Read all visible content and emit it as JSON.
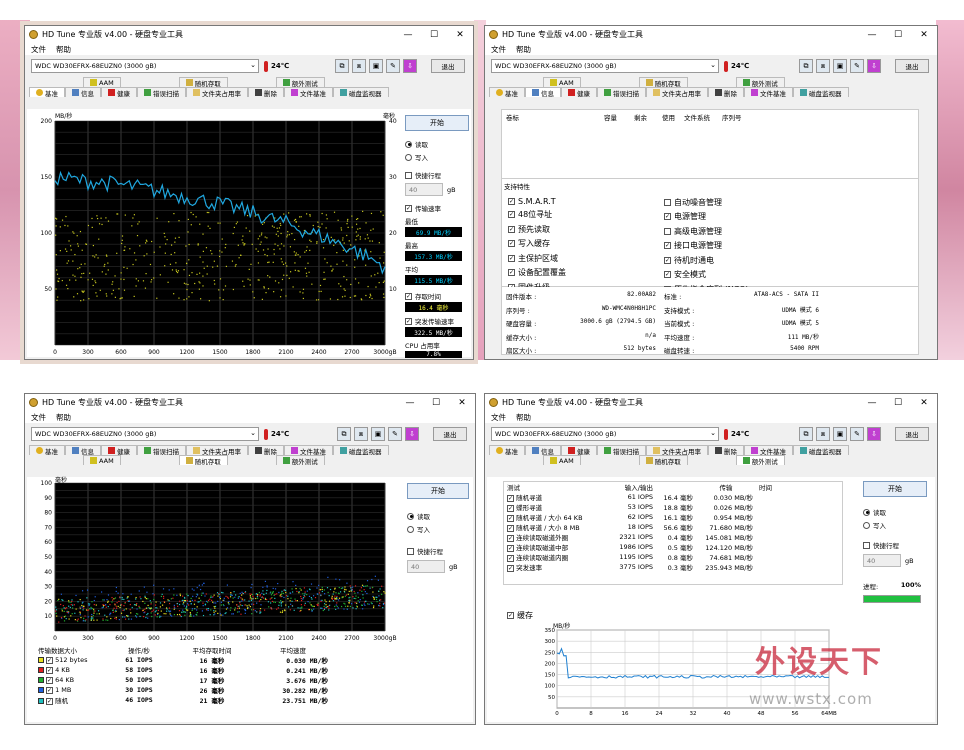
{
  "app": {
    "title": "HD Tune 专业版 v4.00 - 硬盘专业工具",
    "menu": [
      "文件",
      "帮助"
    ],
    "drive": "WDC WD30EFRX-68EUZN0 (3000 gB)",
    "temp": "24℃",
    "exit_label": "退出",
    "tabs_top": [
      "AAM",
      "随机存取",
      "额外测试"
    ],
    "tabs_bottom": [
      "基准",
      "信息",
      "健康",
      "错误扫描",
      "文件夹占用率",
      "删除",
      "文件基准",
      "磁盘监视器"
    ]
  },
  "benchmark": {
    "unit_left": "MB/秒",
    "unit_right": "毫秒",
    "start": "开始",
    "read": "读取",
    "write": "写入",
    "quick": "快捷行程",
    "quick_val": "40",
    "quick_unit": "gB",
    "transfer_rate": "传输速率",
    "min_label": "最低",
    "min_val": "69.9 MB/秒",
    "max_label": "最高",
    "max_val": "157.3 MB/秒",
    "avg_label": "平均",
    "avg_val": "115.5 MB/秒",
    "access_label": "存取时间",
    "access_val": "16.4 毫秒",
    "burst_label": "突发传输速率",
    "burst_val": "322.5 MB/秒",
    "cpu_label": "CPU 占用率",
    "cpu_val": "7.8%"
  },
  "chart_data": [
    {
      "type": "line",
      "title": "",
      "xlabel": "",
      "ylabel": "MB/秒",
      "y2label": "毫秒",
      "x_ticks": [
        "0",
        "300",
        "600",
        "900",
        "1200",
        "1500",
        "1800",
        "2100",
        "2400",
        "2700",
        "3000gB"
      ],
      "y_ticks": [
        "200",
        "150",
        "100",
        "50"
      ],
      "y2_ticks": [
        "40",
        "30",
        "20",
        "10"
      ],
      "ylim": [
        0,
        200
      ],
      "y2lim": [
        0,
        40
      ],
      "series": [
        {
          "name": "传输速率",
          "x": [
            0,
            150,
            300,
            450,
            600,
            750,
            900,
            1050,
            1200,
            1350,
            1500,
            1650,
            1800,
            1950,
            2100,
            2250,
            2400,
            2550,
            2700,
            2850,
            3000
          ],
          "values": [
            150,
            148,
            146,
            145,
            143,
            141,
            138,
            135,
            132,
            129,
            126,
            122,
            118,
            113,
            109,
            103,
            98,
            92,
            86,
            78,
            70
          ]
        }
      ]
    },
    {
      "type": "scatter",
      "title": "",
      "ylabel": "毫秒",
      "x_ticks": [
        "0",
        "300",
        "600",
        "900",
        "1200",
        "1500",
        "1800",
        "2100",
        "2400",
        "2700",
        "3000gB"
      ],
      "y_ticks": [
        "100",
        "90",
        "80",
        "70",
        "60",
        "50",
        "40",
        "30",
        "20",
        "10"
      ],
      "ylim": [
        0,
        100
      ]
    },
    {
      "type": "line",
      "title": "",
      "ylabel": "MB/秒",
      "x_ticks": [
        "0",
        "8",
        "16",
        "24",
        "32",
        "40",
        "48",
        "56",
        "64MB"
      ],
      "y_ticks": [
        "350",
        "300",
        "250",
        "200",
        "150",
        "100",
        "50"
      ],
      "ylim": [
        0,
        350
      ]
    }
  ],
  "info": {
    "cols": [
      "卷标",
      "容量",
      "剩余",
      "使用",
      "文件系统",
      "序列号"
    ],
    "features_label": "支持特性",
    "features_left": [
      "S.M.A.R.T",
      "48位寻址",
      "预先读取",
      "写入缓存",
      "主保护区域",
      "设备配置覆盖",
      "固件升级"
    ],
    "features_right": [
      "自动噪音管理",
      "电源管理",
      "高级电源管理",
      "接口电源管理",
      "待机时通电",
      "安全模式",
      "原生指令序列 (NCQ)"
    ],
    "right_checked": [
      false,
      true,
      false,
      true,
      true,
      true,
      true
    ],
    "left_details": [
      [
        "固件版本 :",
        "82.00A82"
      ],
      [
        "序列号 :",
        "WD-WMC4N0H8H1PC"
      ],
      [
        "硬盘容量 :",
        "3000.6 gB (2794.5 GB)"
      ],
      [
        "缓存大小 :",
        "n/a"
      ],
      [
        "扇区大小 :",
        "512 bytes"
      ]
    ],
    "right_details": [
      [
        "标准 :",
        "ATA8-ACS - SATA II"
      ],
      [
        "支持模式 :",
        "UDMA 模式 6"
      ],
      [
        "当前模式 :",
        "UDMA 模式 5"
      ],
      [
        "平均速度 :",
        "111 MB/秒"
      ],
      [
        "磁盘转速 :",
        "5400 RPM"
      ]
    ]
  },
  "random": {
    "unit": "毫秒",
    "headers": [
      "传输数据大小",
      "操作/秒",
      "平均存取时间",
      "平均速度"
    ],
    "rows": [
      {
        "size": "512 bytes",
        "iops": "61 IOPS",
        "access": "16 毫秒",
        "speed": "0.030 MB/秒",
        "color": "#e8e020"
      },
      {
        "size": "4 KB",
        "iops": "58 IOPS",
        "access": "16 毫秒",
        "speed": "0.241 MB/秒",
        "color": "#e02020"
      },
      {
        "size": "64 KB",
        "iops": "50 IOPS",
        "access": "17 毫秒",
        "speed": "3.676 MB/秒",
        "color": "#20b030"
      },
      {
        "size": "1 MB",
        "iops": "30 IOPS",
        "access": "26 毫秒",
        "speed": "30.282 MB/秒",
        "color": "#2060e0"
      },
      {
        "size": "随机",
        "iops": "46 IOPS",
        "access": "21 毫秒",
        "speed": "23.751 MB/秒",
        "color": "#20c0c0"
      }
    ]
  },
  "extra": {
    "headers": [
      "测试",
      "输入/输出",
      "",
      "传输"
    ],
    "rows": [
      {
        "name": "随机寻道",
        "io": "61 IOPS",
        "ms": "16.4 毫秒",
        "rate": "0.030 MB/秒"
      },
      {
        "name": "蝶形寻道",
        "io": "53 IOPS",
        "ms": "18.8 毫秒",
        "rate": "0.026 MB/秒"
      },
      {
        "name": "随机寻道 / 大小 64 KB",
        "io": "62 IOPS",
        "ms": "16.1 毫秒",
        "rate": "0.954 MB/秒"
      },
      {
        "name": "随机寻道 / 大小 8 MB",
        "io": "18 IOPS",
        "ms": "56.6 毫秒",
        "rate": "71.680 MB/秒"
      },
      {
        "name": "连续读取磁道外圈",
        "io": "2321 IOPS",
        "ms": "0.4 毫秒",
        "rate": "145.081 MB/秒"
      },
      {
        "name": "连续读取磁道中部",
        "io": "1986 IOPS",
        "ms": "0.5 毫秒",
        "rate": "124.120 MB/秒"
      },
      {
        "name": "连续读取磁道内圈",
        "io": "1195 IOPS",
        "ms": "0.8 毫秒",
        "rate": "74.681 MB/秒"
      },
      {
        "name": "突发速率",
        "io": "3775 IOPS",
        "ms": "0.3 毫秒",
        "rate": "235.943 MB/秒"
      }
    ],
    "time_label": "时间",
    "cache_label": "缓存",
    "progress_label": "进程:",
    "progress_val": "100%",
    "progress": 1.0
  },
  "watermark": {
    "cn": "外设天下",
    "url": "www.wstx.com"
  }
}
